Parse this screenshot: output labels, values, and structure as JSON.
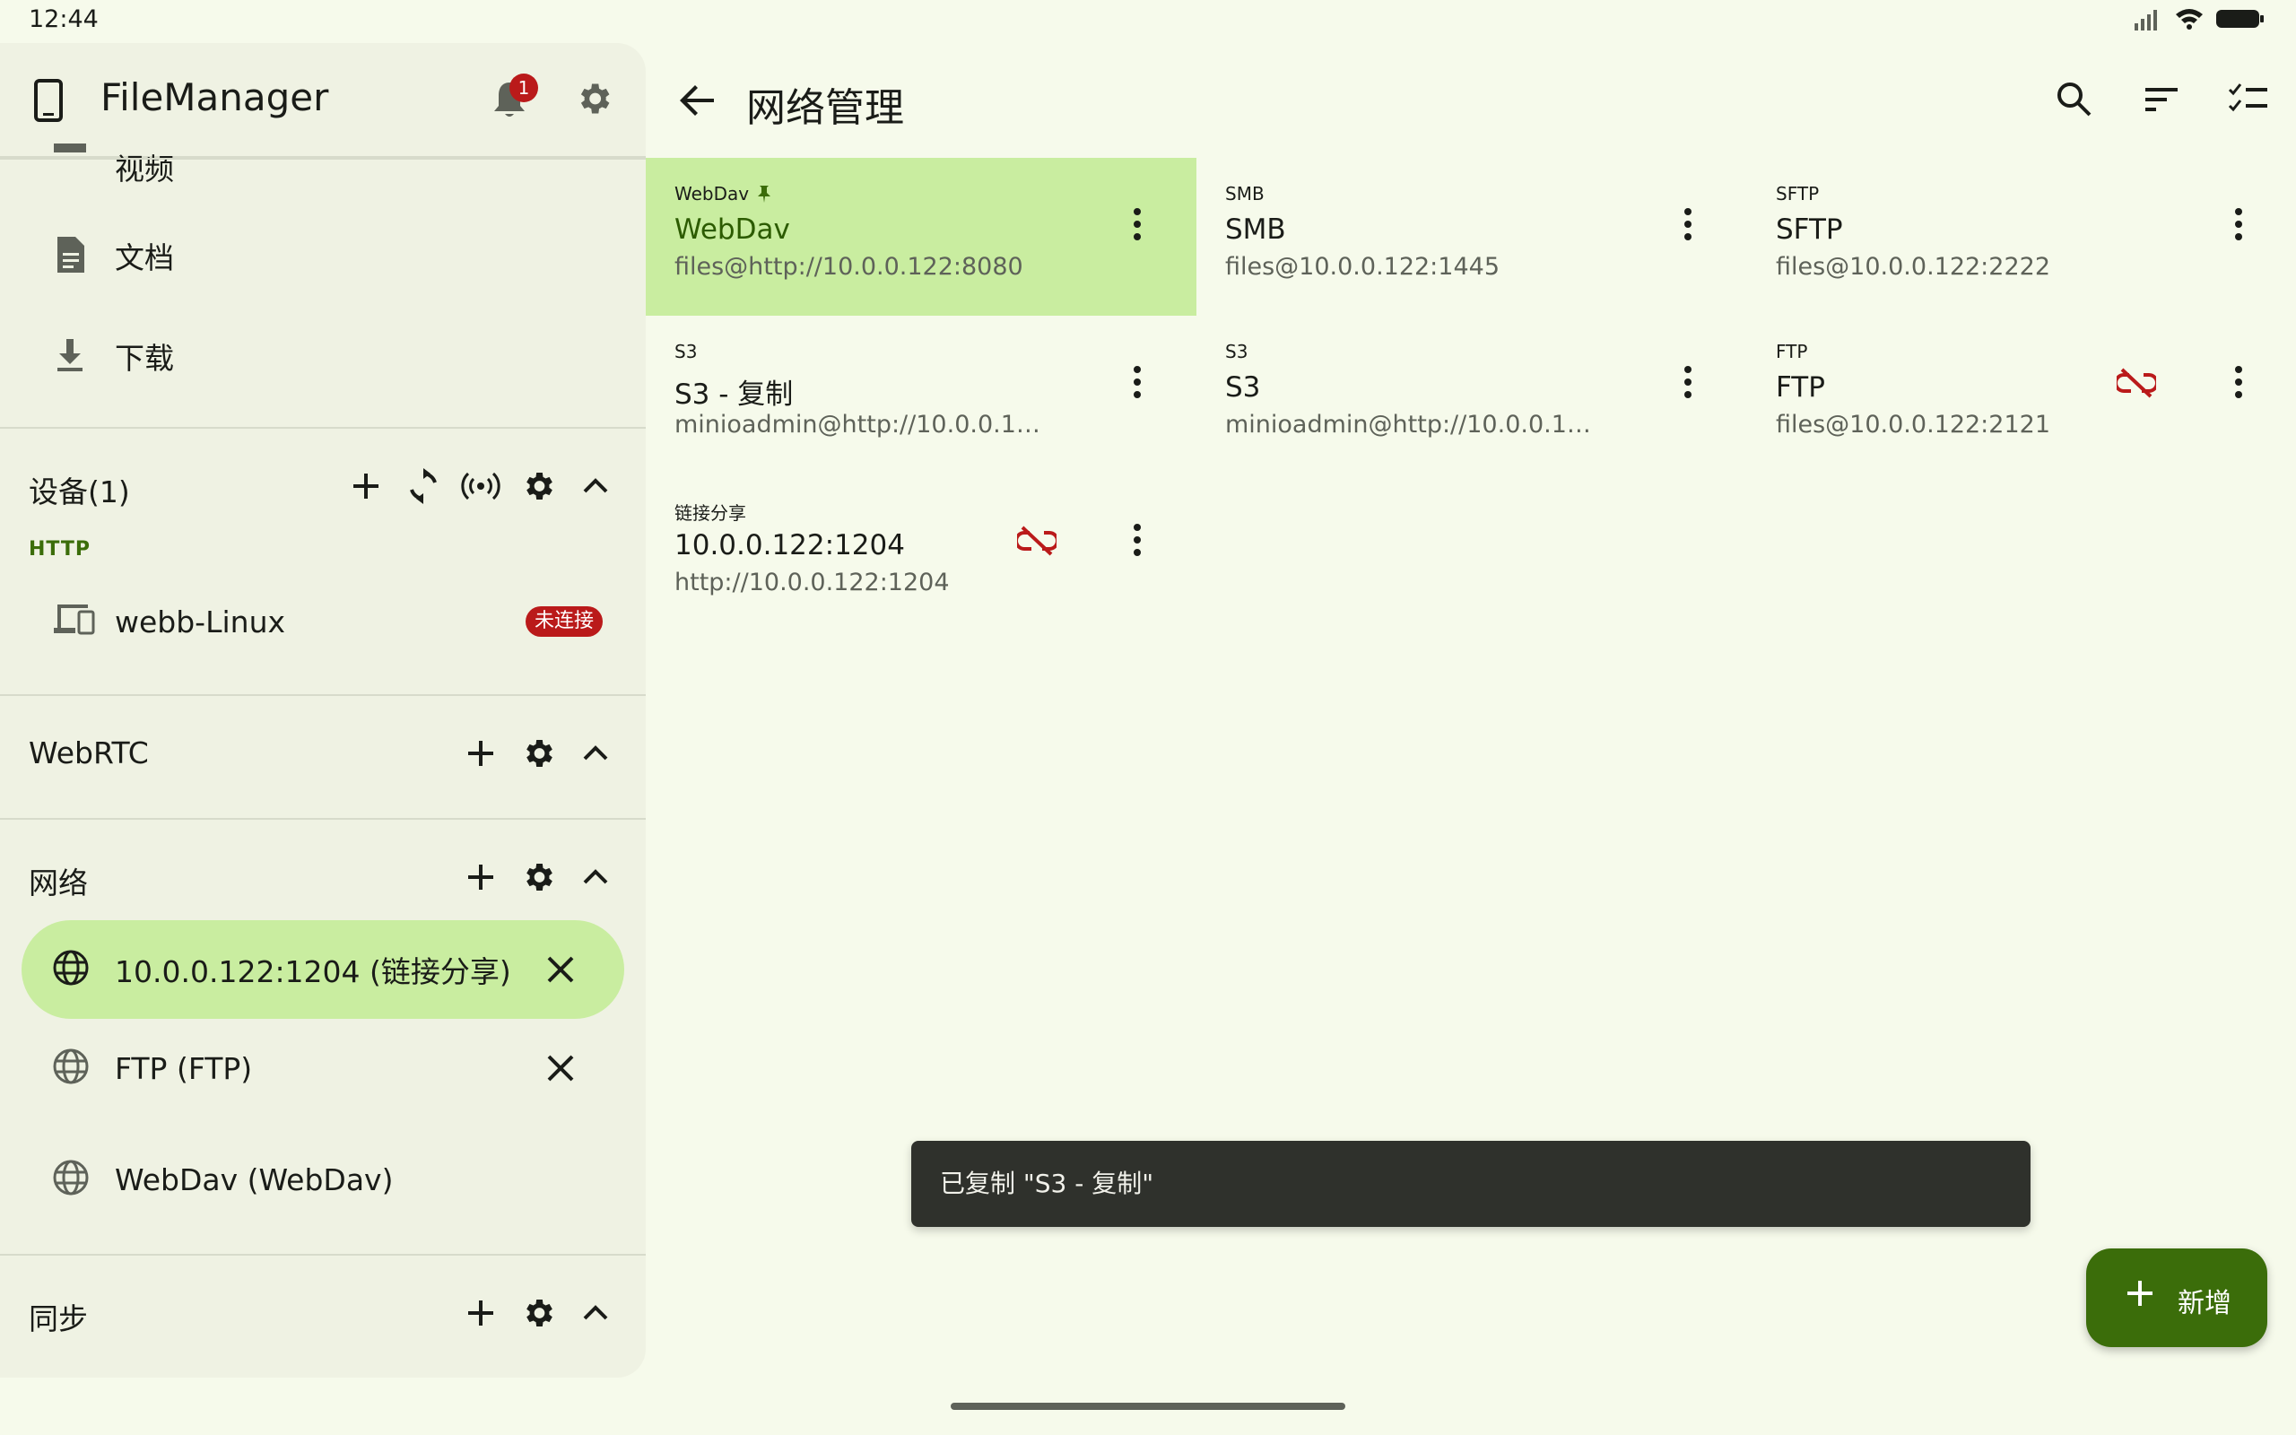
{
  "status_bar": {
    "time": "12:44"
  },
  "drawer": {
    "app_title": "FileManager",
    "notification_count": "1",
    "items": [
      {
        "label": "视频",
        "icon": "video-icon"
      },
      {
        "label": "文档",
        "icon": "document-icon"
      },
      {
        "label": "下载",
        "icon": "download-icon"
      }
    ],
    "devices": {
      "title": "设备(1)",
      "subheading": "HTTP",
      "device_name": "webb-Linux",
      "status": "未连接"
    },
    "webrtc": {
      "title": "WebRTC"
    },
    "network": {
      "title": "网络",
      "items": [
        {
          "label": "10.0.0.122:1204 (链接分享)",
          "active": true
        },
        {
          "label": "FTP (FTP)",
          "active": false
        },
        {
          "label": "WebDav (WebDav)",
          "active": false
        }
      ]
    },
    "sync": {
      "title": "同步"
    }
  },
  "main": {
    "title": "网络管理",
    "cards": [
      {
        "type": "WebDav",
        "name": "WebDav",
        "address": "files@http://10.0.0.122:8080",
        "pinned": true,
        "selected": true,
        "unlinked": false
      },
      {
        "type": "SMB",
        "name": "SMB",
        "address": "files@10.0.0.122:1445",
        "pinned": false,
        "selected": false,
        "unlinked": false
      },
      {
        "type": "SFTP",
        "name": "SFTP",
        "address": "files@10.0.0.122:2222",
        "pinned": false,
        "selected": false,
        "unlinked": false
      },
      {
        "type": "S3",
        "name": "S3 - 复制",
        "address": "minioadmin@http://10.0.0.122:...",
        "pinned": false,
        "selected": false,
        "unlinked": false
      },
      {
        "type": "S3",
        "name": "S3",
        "address": "minioadmin@http://10.0.0.122:...",
        "pinned": false,
        "selected": false,
        "unlinked": false
      },
      {
        "type": "FTP",
        "name": "FTP",
        "address": "files@10.0.0.122:2121",
        "pinned": false,
        "selected": false,
        "unlinked": true
      },
      {
        "type": "链接分享",
        "name": "10.0.0.122:1204",
        "address": "http://10.0.0.122:1204",
        "pinned": false,
        "selected": false,
        "unlinked": true
      }
    ],
    "snackbar": "已复制 \"S3 - 复制\"",
    "fab_label": "新增"
  },
  "colors": {
    "background": "#f6faeb",
    "drawer": "#eff2e3",
    "selected": "#c9eda0",
    "accent": "#3b6d0a",
    "error": "#ba1a1a"
  }
}
